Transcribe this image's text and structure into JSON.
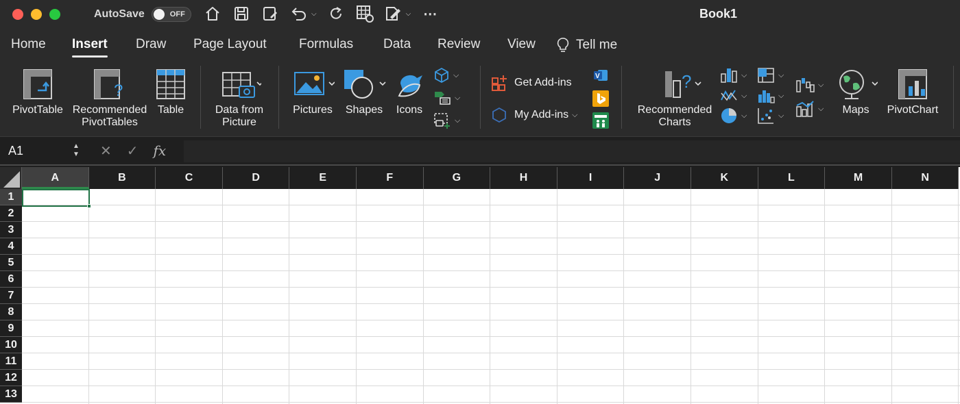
{
  "window": {
    "title": "Book1",
    "autosave_label": "AutoSave",
    "autosave_state": "OFF"
  },
  "tabs": [
    "Home",
    "Insert",
    "Draw",
    "Page Layout",
    "Formulas",
    "Data",
    "Review",
    "View",
    "Tell me"
  ],
  "active_tab": "Insert",
  "ribbon": {
    "pivottable": "PivotTable",
    "recommended_pivot_1": "Recommended",
    "recommended_pivot_2": "PivotTables",
    "table": "Table",
    "data_from_1": "Data from",
    "data_from_2": "Picture",
    "pictures": "Pictures",
    "shapes": "Shapes",
    "icons": "Icons",
    "get_addins": "Get Add-ins",
    "my_addins": "My Add-ins",
    "recommended_charts_1": "Recommended",
    "recommended_charts_2": "Charts",
    "maps": "Maps",
    "pivotchart": "PivotChart"
  },
  "formula_bar": {
    "name_box": "A1",
    "formula": ""
  },
  "columns": [
    "A",
    "B",
    "C",
    "D",
    "E",
    "F",
    "G",
    "H",
    "I",
    "J",
    "K",
    "L",
    "M",
    "N"
  ],
  "rows": [
    "1",
    "2",
    "3",
    "4",
    "5",
    "6",
    "7",
    "8",
    "9",
    "10",
    "11",
    "12",
    "13"
  ],
  "selected_cell": "A1",
  "colors": {
    "accent_green": "#217346",
    "tab_bar": "#2b2b2b",
    "sheet": "#ffffff"
  }
}
